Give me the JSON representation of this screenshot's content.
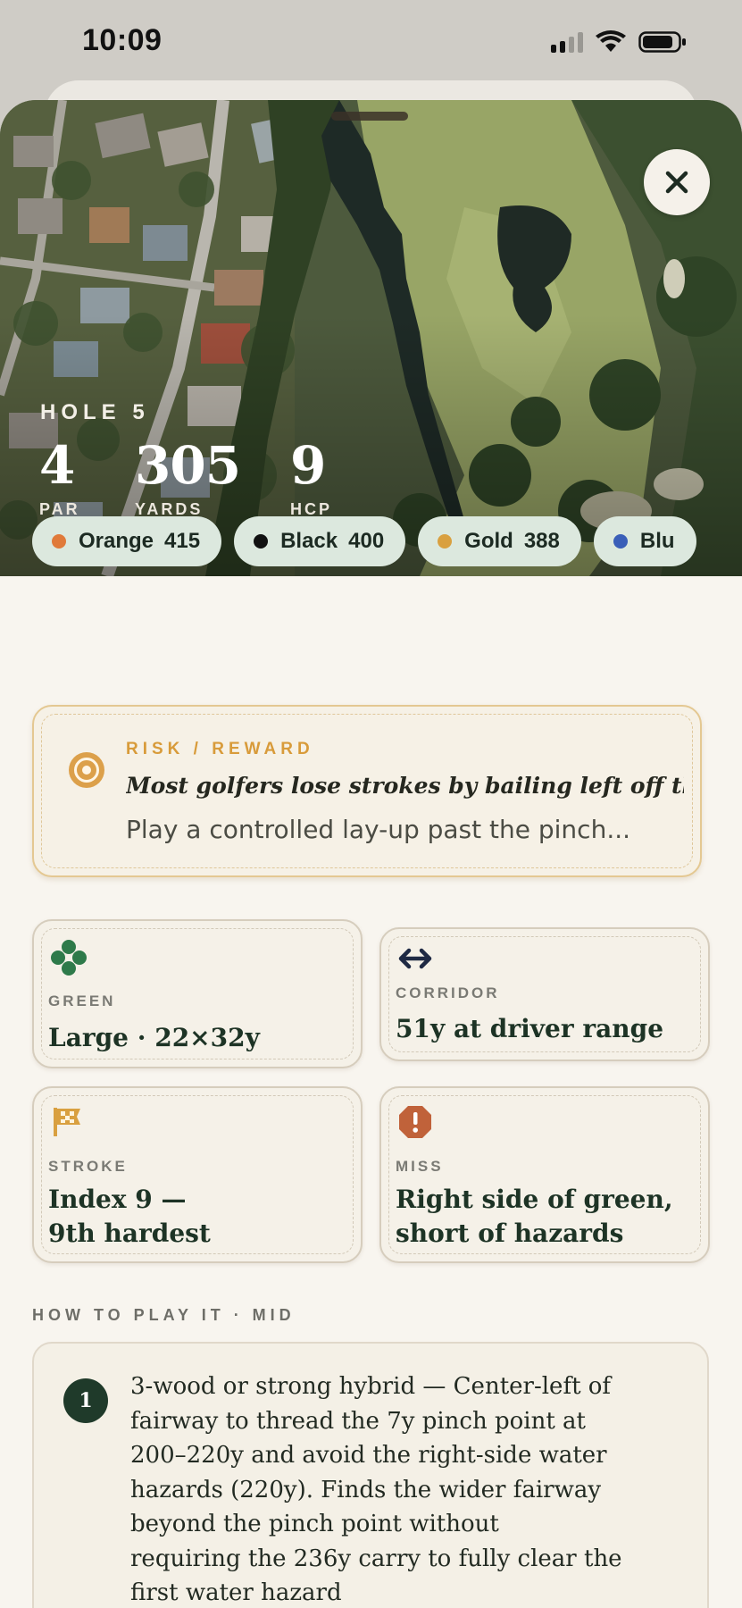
{
  "status_bar": {
    "time": "10:09"
  },
  "hero": {
    "hole_label": "HOLE 5",
    "stats": [
      {
        "value": "4",
        "label": "PAR"
      },
      {
        "value": "305",
        "label": "YARDS"
      },
      {
        "value": "9",
        "label": "HCP"
      }
    ],
    "close_icon": "close-icon"
  },
  "tees": [
    {
      "name": "Orange",
      "yards": "415",
      "color": "#e07a3a"
    },
    {
      "name": "Black",
      "yards": "400",
      "color": "#111111"
    },
    {
      "name": "Gold",
      "yards": "388",
      "color": "#d9a040"
    },
    {
      "name": "Blu",
      "yards": "",
      "color": "#3a5fb8"
    }
  ],
  "risk": {
    "icon": "target-icon",
    "kicker": "RISK / REWARD",
    "lead": "Most golfers lose strokes by bailing left off th...",
    "body": "Play a controlled lay-up past the pinch..."
  },
  "cards": {
    "green": {
      "icon": "clover-icon",
      "label": "GREEN",
      "value": "Large · 22×32y",
      "icon_color": "#2e7a4a"
    },
    "corridor": {
      "icon": "double-arrow-icon",
      "label": "CORRIDOR",
      "value": "51y at driver range",
      "icon_color": "#1f2a44"
    },
    "stroke": {
      "icon": "checkered-flag-icon",
      "label": "STROKE",
      "value_line1": "Index 9 —",
      "value_line2": "9th hardest",
      "icon_color": "#d9a040"
    },
    "miss": {
      "icon": "alert-octagon-icon",
      "label": "MISS",
      "value_line1": "Right side of green,",
      "value_line2": "short of hazards",
      "icon_color": "#c0623a"
    }
  },
  "how_to_play": {
    "title": "HOW TO PLAY IT · MID",
    "steps": [
      {
        "number": "1",
        "lines": [
          "3-wood or strong hybrid — Center-left of",
          "fairway to thread the 7y pinch point at",
          "200–220y and avoid the right-side water",
          "hazards (220y). Finds the wider fairway",
          "beyond the pinch point without",
          "requiring the 236y carry to fully clear the",
          "first water hazard"
        ]
      }
    ]
  }
}
